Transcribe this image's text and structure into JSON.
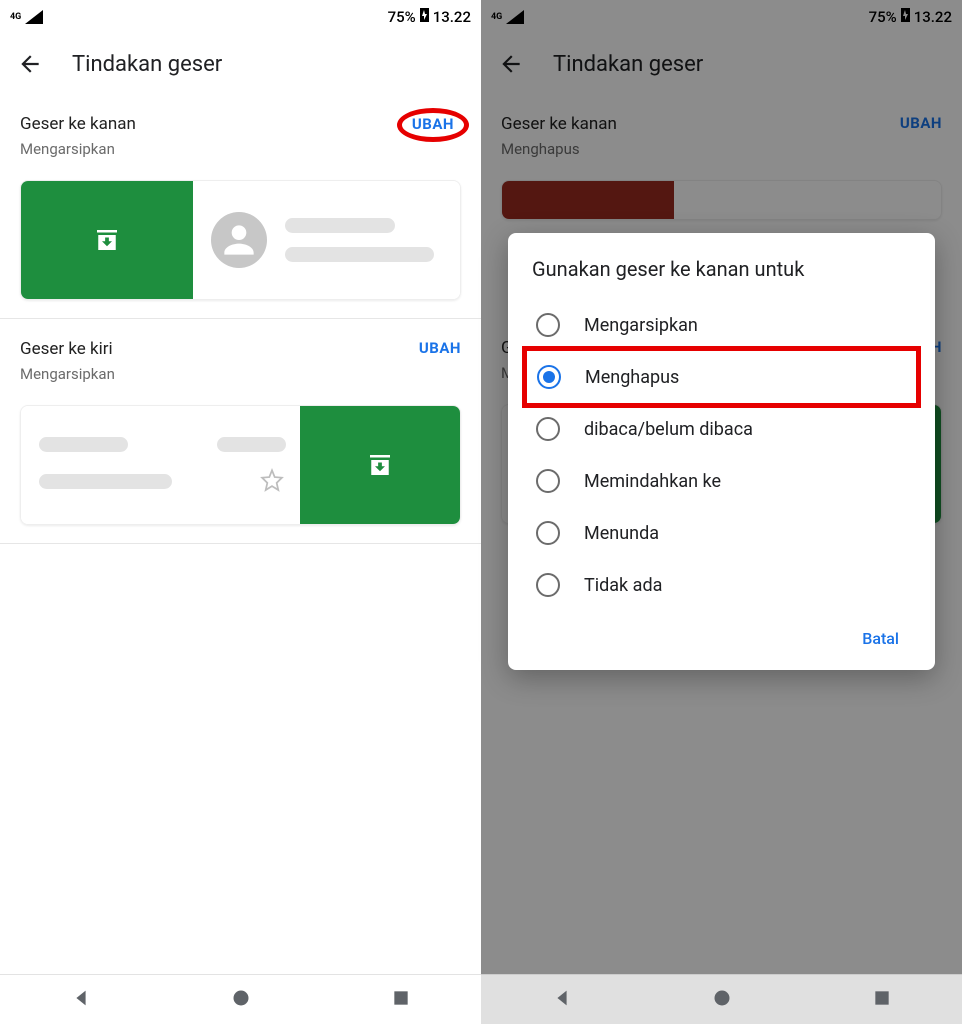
{
  "status": {
    "network": "4G",
    "battery_pct": "75%",
    "time": "13.22"
  },
  "appbar": {
    "title": "Tindakan geser"
  },
  "left_screen": {
    "right_swipe": {
      "title": "Geser ke kanan",
      "sub": "Mengarsipkan",
      "change": "UBAH"
    },
    "left_swipe": {
      "title": "Geser ke kiri",
      "sub": "Mengarsipkan",
      "change": "UBAH"
    }
  },
  "right_screen": {
    "right_swipe": {
      "title": "Geser ke kanan",
      "sub": "Menghapus",
      "change": "UBAH"
    },
    "left_swipe": {
      "title_visible": "G",
      "sub_visible": "M",
      "change_visible": "H"
    }
  },
  "dialog": {
    "title": "Gunakan geser ke kanan untuk",
    "options": [
      "Mengarsipkan",
      "Menghapus",
      "dibaca/belum dibaca",
      "Memindahkan ke",
      "Menunda",
      "Tidak ada"
    ],
    "selected_index": 1,
    "highlighted_index": 1,
    "cancel": "Batal"
  },
  "colors": {
    "archive": "#1e8e3e",
    "delete": "#9a2a1f",
    "link": "#1a73e8",
    "highlight_border": "#e60000"
  }
}
